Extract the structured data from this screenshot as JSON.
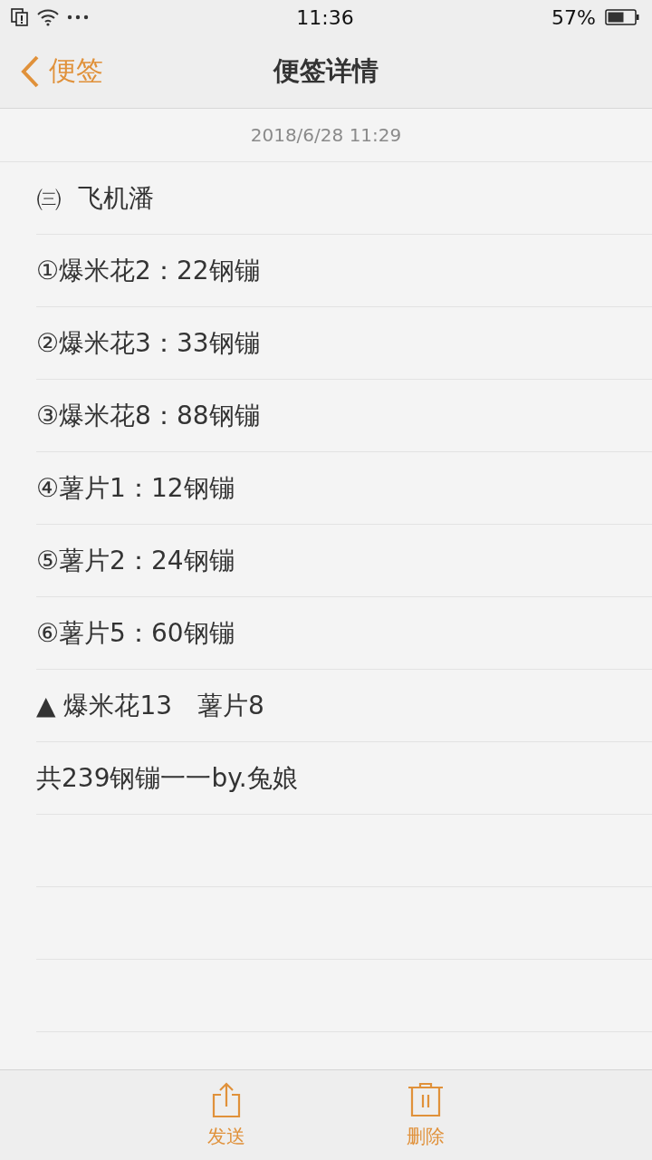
{
  "status_bar": {
    "time": "11:36",
    "battery": "57%"
  },
  "nav": {
    "back": "便签",
    "title": "便签详情"
  },
  "note": {
    "date": "2018/6/28 11:29",
    "lines": [
      "㈢  飞机潘",
      "①爆米花2：22钢镚",
      "②爆米花3：33钢镚",
      "③爆米花8：88钢镚",
      "④薯片1：12钢镚",
      "⑤薯片2：24钢镚",
      "⑥薯片5：60钢镚",
      "▲ 爆米花13　薯片8",
      "共239钢镚一一by.兔娘"
    ]
  },
  "toolbar": [
    {
      "kind": "send",
      "label": "发送"
    },
    {
      "kind": "delete",
      "label": "删除"
    }
  ]
}
